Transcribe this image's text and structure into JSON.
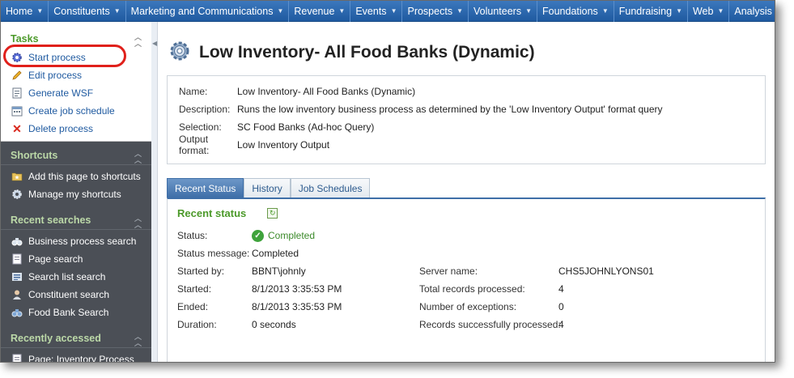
{
  "nav": {
    "items": [
      "Home",
      "Constituents",
      "Marketing and Communications",
      "Revenue",
      "Events",
      "Prospects",
      "Volunteers",
      "Foundations",
      "Fundraising",
      "Web",
      "Analysis"
    ],
    "more_label": "»"
  },
  "tasks": {
    "title": "Tasks",
    "items": [
      "Start process",
      "Edit process",
      "Generate WSF",
      "Create job schedule",
      "Delete process"
    ]
  },
  "shortcuts": {
    "title": "Shortcuts",
    "items": [
      "Add this page to shortcuts",
      "Manage my shortcuts"
    ]
  },
  "recent_searches": {
    "title": "Recent searches",
    "items": [
      "Business process search",
      "Page search",
      "Search list search",
      "Constituent search",
      "Food Bank Search"
    ]
  },
  "recently_accessed": {
    "title": "Recently accessed",
    "items": [
      "Page: Inventory Process"
    ]
  },
  "page": {
    "title": "Low Inventory- All Food Banks (Dynamic)"
  },
  "summary": {
    "name_label": "Name:",
    "name_value": "Low Inventory- All Food Banks (Dynamic)",
    "description_label": "Description:",
    "description_value": "Runs the low inventory business process as determined by the 'Low Inventory Output' format query",
    "selection_label": "Selection:",
    "selection_value": "SC Food Banks (Ad-hoc Query)",
    "output_label": "Output format:",
    "output_value": "Low Inventory Output"
  },
  "tabs": [
    "Recent Status",
    "History",
    "Job Schedules"
  ],
  "status": {
    "title": "Recent status",
    "status_label": "Status:",
    "status_value": "Completed",
    "message_label": "Status message:",
    "message_value": "Completed",
    "started_by_label": "Started by:",
    "started_by_value": "BBNT\\johnly",
    "started_label": "Started:",
    "started_value": "8/1/2013 3:35:53 PM",
    "ended_label": "Ended:",
    "ended_value": "8/1/2013 3:35:53 PM",
    "duration_label": "Duration:",
    "duration_value": "0 seconds",
    "server_label": "Server name:",
    "server_value": "CHS5JOHNLYONS01",
    "total_label": "Total records processed:",
    "total_value": "4",
    "exceptions_label": "Number of exceptions:",
    "exceptions_value": "0",
    "success_label": "Records successfully processed:",
    "success_value": "4"
  },
  "colors": {
    "nav_bg": "#2a66ad",
    "sidebar_bg": "#4b4f56",
    "section_green": "#4c9a2a",
    "highlight_red": "#e0201b"
  }
}
